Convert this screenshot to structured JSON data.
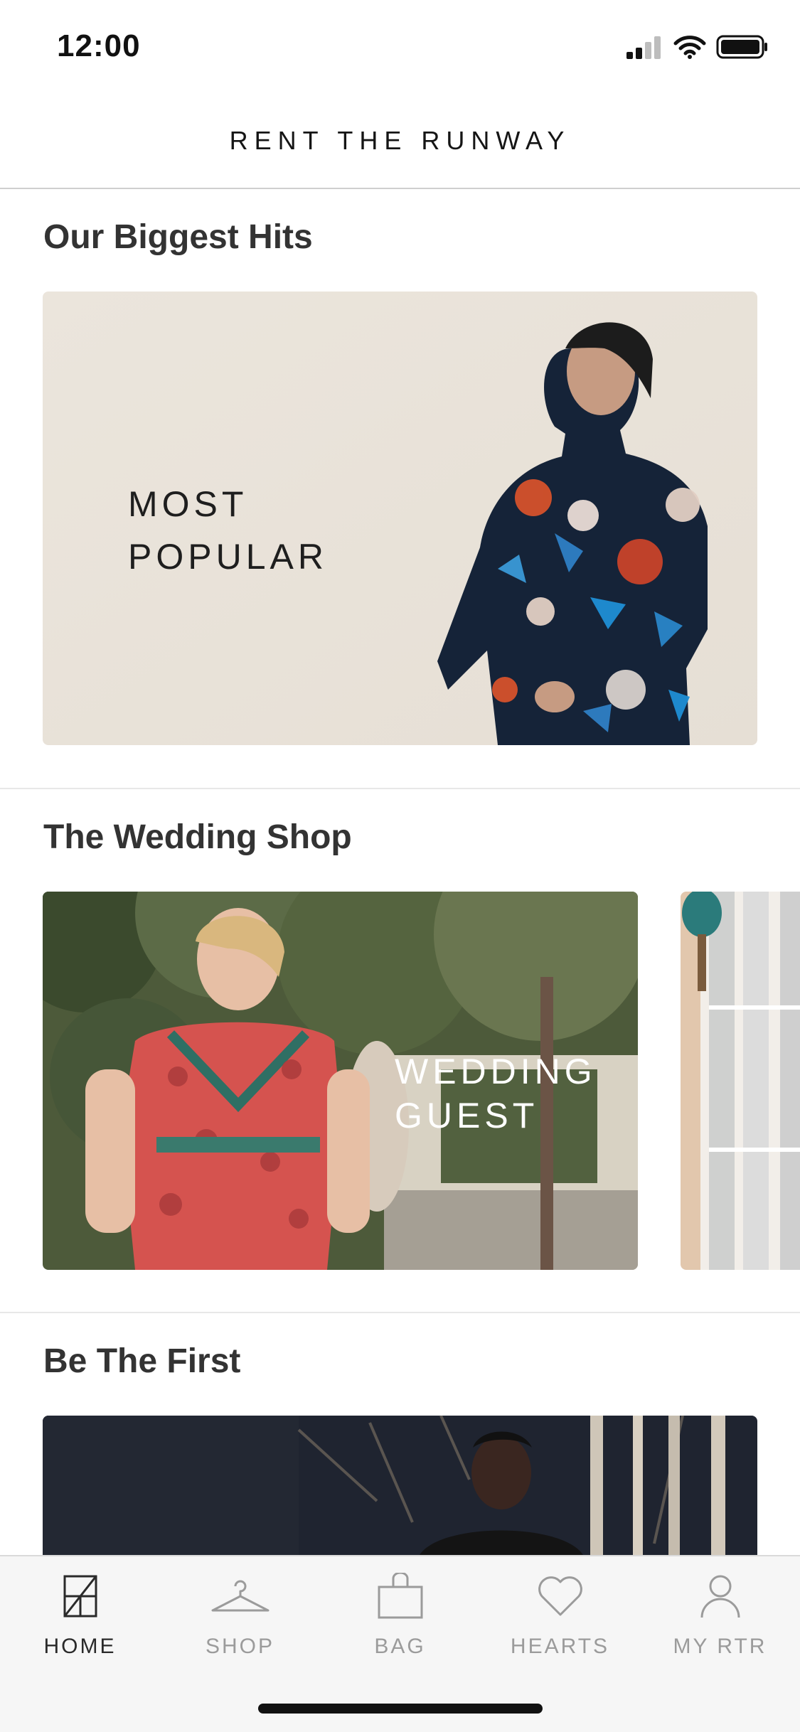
{
  "status_bar": {
    "time": "12:00"
  },
  "header": {
    "brand": "RENT THE RUNWAY"
  },
  "sections": [
    {
      "title": "Our Biggest Hits",
      "card_label": "MOST\nPOPULAR"
    },
    {
      "title": "The Wedding Shop",
      "card_label": "WEDDING\nGUEST"
    },
    {
      "title": "Be The First"
    }
  ],
  "tabs": [
    {
      "label": "HOME",
      "icon": "home-icon",
      "active": true
    },
    {
      "label": "SHOP",
      "icon": "hanger-icon"
    },
    {
      "label": "BAG",
      "icon": "bag-icon"
    },
    {
      "label": "HEARTS",
      "icon": "heart-icon"
    },
    {
      "label": "MY RTR",
      "icon": "person-icon"
    }
  ],
  "colors": {
    "text_dark": "#2b2b2b",
    "tab_inactive": "#9b9b9b",
    "card_beige": "#e9e3da"
  }
}
